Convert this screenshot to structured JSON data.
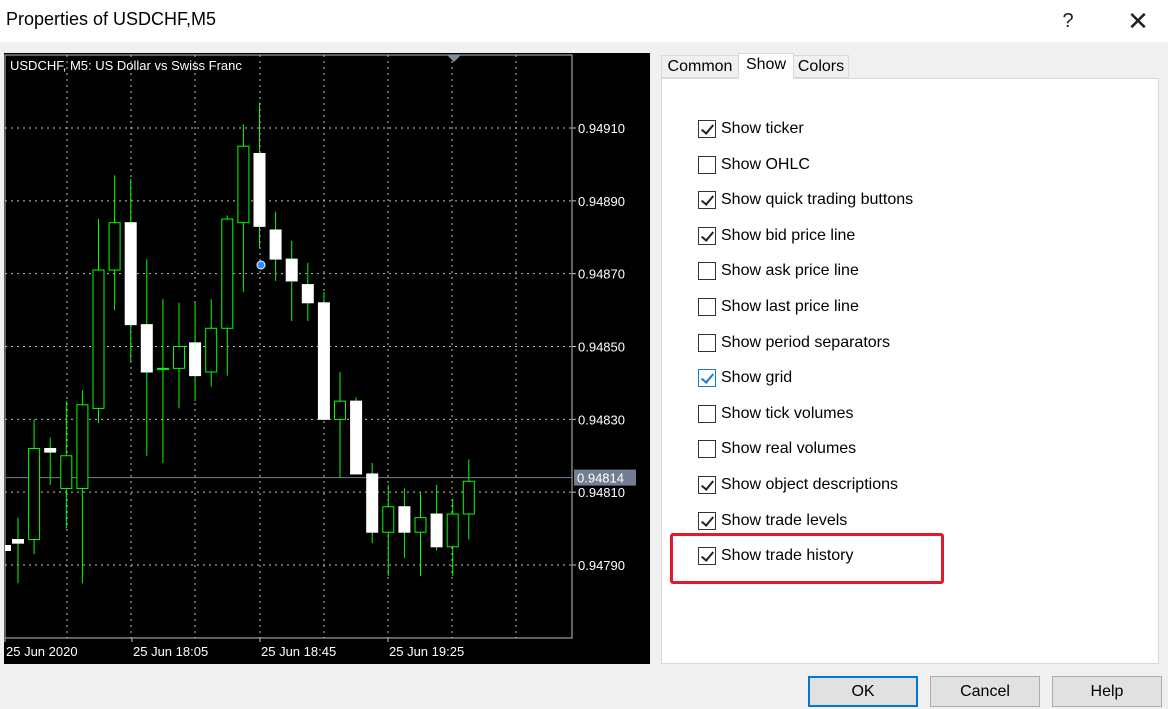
{
  "window": {
    "title": "Properties of USDCHF,M5",
    "help_glyph": "?",
    "close_glyph": "✕"
  },
  "chart": {
    "symbol_label": "USDCHF, M5:  US Dollar vs Swiss Franc",
    "background_color": "#000000",
    "bull_color": "#00ff00",
    "candle_body_color": "#ffffff",
    "grid_color": "#c0c0c0",
    "bid_line_color": "#708090",
    "price_axis": [
      "0.94910",
      "0.94890",
      "0.94870",
      "0.94850",
      "0.94830",
      "0.94810",
      "0.94790"
    ],
    "current_price": "0.94814",
    "time_axis": [
      "25 Jun 2020",
      "25 Jun 18:05",
      "25 Jun 18:45",
      "25 Jun 19:25"
    ],
    "candles": [
      {
        "o": 0.94797,
        "h": 0.94803,
        "l": 0.94785,
        "c": 0.94796
      },
      {
        "o": 0.94797,
        "h": 0.9483,
        "l": 0.94793,
        "c": 0.94822
      },
      {
        "o": 0.94822,
        "h": 0.94825,
        "l": 0.94812,
        "c": 0.94821
      },
      {
        "o": 0.94811,
        "h": 0.94835,
        "l": 0.948,
        "c": 0.9482
      },
      {
        "o": 0.94811,
        "h": 0.94838,
        "l": 0.94785,
        "c": 0.94834
      },
      {
        "o": 0.94833,
        "h": 0.94885,
        "l": 0.94829,
        "c": 0.94871
      },
      {
        "o": 0.94871,
        "h": 0.94897,
        "l": 0.9486,
        "c": 0.94884
      },
      {
        "o": 0.94884,
        "h": 0.94896,
        "l": 0.94846,
        "c": 0.94856
      },
      {
        "o": 0.94856,
        "h": 0.94874,
        "l": 0.9482,
        "c": 0.94843
      },
      {
        "o": 0.94844,
        "h": 0.94863,
        "l": 0.94818,
        "c": 0.94844
      },
      {
        "o": 0.94844,
        "h": 0.94862,
        "l": 0.94833,
        "c": 0.9485
      },
      {
        "o": 0.94851,
        "h": 0.94862,
        "l": 0.94835,
        "c": 0.94842
      },
      {
        "o": 0.94843,
        "h": 0.94863,
        "l": 0.94839,
        "c": 0.94855
      },
      {
        "o": 0.94855,
        "h": 0.94886,
        "l": 0.94842,
        "c": 0.94885
      },
      {
        "o": 0.94884,
        "h": 0.94911,
        "l": 0.94865,
        "c": 0.94905
      },
      {
        "o": 0.94903,
        "h": 0.94917,
        "l": 0.94877,
        "c": 0.94883
      },
      {
        "o": 0.94882,
        "h": 0.94887,
        "l": 0.94868,
        "c": 0.94874
      },
      {
        "o": 0.94874,
        "h": 0.94879,
        "l": 0.94857,
        "c": 0.94868
      },
      {
        "o": 0.94867,
        "h": 0.94873,
        "l": 0.94857,
        "c": 0.94862
      },
      {
        "o": 0.94862,
        "h": 0.94865,
        "l": 0.9483,
        "c": 0.9483
      },
      {
        "o": 0.9483,
        "h": 0.94843,
        "l": 0.94814,
        "c": 0.94835
      },
      {
        "o": 0.94835,
        "h": 0.94836,
        "l": 0.94815,
        "c": 0.94815
      },
      {
        "o": 0.94815,
        "h": 0.94818,
        "l": 0.94796,
        "c": 0.94799
      },
      {
        "o": 0.94799,
        "h": 0.94812,
        "l": 0.94787,
        "c": 0.94806
      },
      {
        "o": 0.94806,
        "h": 0.94811,
        "l": 0.94792,
        "c": 0.94799
      },
      {
        "o": 0.94799,
        "h": 0.9481,
        "l": 0.94787,
        "c": 0.94803
      },
      {
        "o": 0.94804,
        "h": 0.94812,
        "l": 0.94794,
        "c": 0.94795
      },
      {
        "o": 0.94795,
        "h": 0.94808,
        "l": 0.94787,
        "c": 0.94804
      },
      {
        "o": 0.94804,
        "h": 0.94819,
        "l": 0.94797,
        "c": 0.94813
      }
    ]
  },
  "tabs": [
    {
      "label": "Common",
      "active": false
    },
    {
      "label": "Show",
      "active": true
    },
    {
      "label": "Colors",
      "active": false
    }
  ],
  "options": [
    {
      "label": "Show ticker",
      "checked": true
    },
    {
      "label": "Show OHLC",
      "checked": false
    },
    {
      "label": "Show quick trading buttons",
      "checked": true
    },
    {
      "label": "Show bid price line",
      "checked": true
    },
    {
      "label": "Show ask price line",
      "checked": false
    },
    {
      "label": "Show last price line",
      "checked": false
    },
    {
      "label": "Show period separators",
      "checked": false
    },
    {
      "label": "Show grid",
      "checked": true,
      "focused": true
    },
    {
      "label": "Show tick volumes",
      "checked": false
    },
    {
      "label": "Show real volumes",
      "checked": false
    },
    {
      "label": "Show object descriptions",
      "checked": true
    },
    {
      "label": "Show trade levels",
      "checked": true
    },
    {
      "label": "Show trade history",
      "checked": true,
      "highlighted": true
    }
  ],
  "buttons": {
    "ok": "OK",
    "cancel": "Cancel",
    "help": "Help"
  },
  "highlight_color": "#e0192f"
}
